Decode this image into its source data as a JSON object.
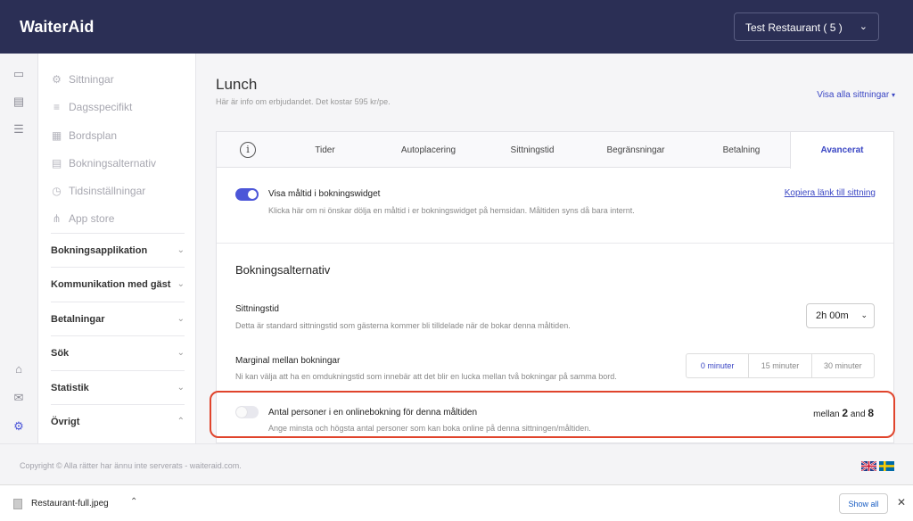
{
  "app": {
    "brand": "WaiterAid"
  },
  "header": {
    "restaurant_select": "Test Restaurant ( 5 )"
  },
  "rail_icons": [
    "calendar-icon",
    "list-icon",
    "sliders-icon",
    "store-icon",
    "mail-icon",
    "gear-icon"
  ],
  "sidebar": {
    "items": [
      {
        "label": "Sittningar",
        "icon": "gear-icon"
      },
      {
        "label": "Dagsspecifikt",
        "icon": "layers-icon"
      },
      {
        "label": "Bordsplan",
        "icon": "table-icon"
      },
      {
        "label": "Bokningsalternativ",
        "icon": "list-icon"
      },
      {
        "label": "Tidsinställningar",
        "icon": "clock-icon"
      },
      {
        "label": "App store",
        "icon": "nodes-icon"
      }
    ],
    "groups": [
      {
        "label": "Bokningsapplikation"
      },
      {
        "label": "Kommunikation med gäst"
      },
      {
        "label": "Betalningar"
      },
      {
        "label": "Sök"
      },
      {
        "label": "Statistik"
      },
      {
        "label": "Övrigt"
      }
    ]
  },
  "page": {
    "title": "Lunch",
    "subtitle": "Här är info om erbjudandet. Det kostar 595 kr/pe.",
    "show_all_link": "Visa alla sittningar"
  },
  "tabs": [
    {
      "label": "Tider"
    },
    {
      "label": "Autoplacering"
    },
    {
      "label": "Sittningstid"
    },
    {
      "label": "Begränsningar"
    },
    {
      "label": "Betalning"
    },
    {
      "label": "Avancerat"
    }
  ],
  "visibility": {
    "title": "Visa måltid i bokningswidget",
    "desc": "Klicka här om ni önskar dölja en måltid i er bokningswidget på hemsidan. Måltiden syns då bara internt.",
    "copy_link": "Kopiera länk till sittning",
    "enabled": true
  },
  "booking_options": {
    "heading": "Bokningsalternativ",
    "seating_time": {
      "title": "Sittningstid",
      "desc": "Detta är standard sittningstid som gästerna kommer bli tilldelade när de bokar denna måltiden.",
      "value": "2h 00m"
    },
    "margin": {
      "title": "Marginal mellan bokningar",
      "desc": "Ni kan välja att ha en omdukningstid som innebär att det blir en lucka mellan två bokningar på samma bord.",
      "options": [
        "0 minuter",
        "15 minuter",
        "30 minuter"
      ],
      "selected": "0 minuter"
    },
    "party_size": {
      "title": "Antal personer i en onlinebokning för denna måltiden",
      "desc": "Ange minsta och högsta antal personer som kan boka online på denna sittningen/måltiden.",
      "prefix": "mellan",
      "min": "2",
      "connector": "and",
      "max": "8",
      "enabled": false
    }
  },
  "footer": {
    "copyright": "Copyright © Alla rätter har ännu inte serverats - waiteraid.com.",
    "languages": [
      "en-flag",
      "sv-flag"
    ]
  },
  "downloads": {
    "file": "Restaurant-full.jpeg",
    "show_all": "Show all"
  },
  "colors": {
    "brand_bg": "#2b2f55",
    "accent": "#3b47c4",
    "highlight": "#e0442c"
  }
}
